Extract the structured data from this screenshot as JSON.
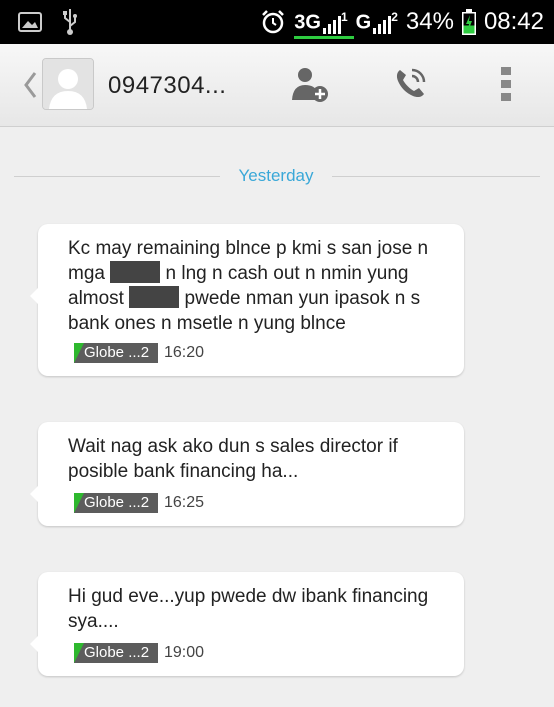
{
  "status_bar": {
    "network1": "3G",
    "network1_sup": "1",
    "network2": "G",
    "network2_sup": "2",
    "battery": "34%",
    "time": "08:42"
  },
  "header": {
    "contact_name": "0947304..."
  },
  "date_divider": "Yesterday",
  "messages": [
    {
      "line1": "Kc may remaining blnce p kmi s san jose n",
      "line2a": "mga",
      "line2b": "n lng n cash out n nmin yung",
      "line3a": "almost",
      "line3b": "pwede nman yun ipasok n s",
      "line4": "bank ones n msetle n yung blnce",
      "sim": "Globe ...2",
      "time": "16:20"
    },
    {
      "text": "Wait nag ask ako dun s sales director if posible bank financing ha...",
      "sim": "Globe ...2",
      "time": "16:25"
    },
    {
      "text": "Hi gud eve...yup pwede dw ibank financing sya....",
      "sim": "Globe ...2",
      "time": "19:00"
    }
  ],
  "colors": {
    "accent": "#3aa8d8",
    "sim_green": "#2eb82e"
  }
}
